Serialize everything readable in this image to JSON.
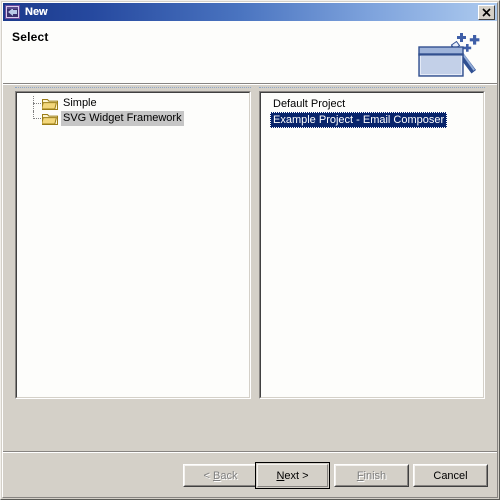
{
  "window": {
    "title": "New",
    "icon": "eclipse-new-wizard-icon",
    "close_label": "✕"
  },
  "header": {
    "title": "Select",
    "banner_icon": "new-wizard-banner-folder-wand-icon"
  },
  "tree": {
    "name": "category-tree",
    "items": [
      {
        "label": "Simple",
        "icon": "folder-icon",
        "selected": false
      },
      {
        "label": "SVG Widget Framework",
        "icon": "folder-icon",
        "selected": true
      }
    ]
  },
  "list": {
    "name": "template-list",
    "items": [
      {
        "label": "Default Project",
        "selected": false
      },
      {
        "label": "Example Project - Email Composer",
        "selected": true
      }
    ]
  },
  "buttons": {
    "back": {
      "label": "< Back",
      "mnemonic": "B",
      "enabled": false,
      "default": false
    },
    "next": {
      "label": "Next >",
      "mnemonic": "N",
      "enabled": true,
      "default": true
    },
    "finish": {
      "label": "Finish",
      "mnemonic": "F",
      "enabled": false,
      "default": false
    },
    "cancel": {
      "label": "Cancel",
      "mnemonic": "",
      "enabled": true,
      "default": false
    }
  },
  "colors": {
    "dialog_face": "#d4d0c8",
    "title_gradient_start": "#1b3a8c",
    "title_gradient_end": "#aecbef",
    "header_background": "#fdfdfb",
    "list_selection": "#08246b",
    "tree_selection": "#c6c6c6",
    "folder_icon": "#f5d97a",
    "disabled_text": "#808080"
  }
}
